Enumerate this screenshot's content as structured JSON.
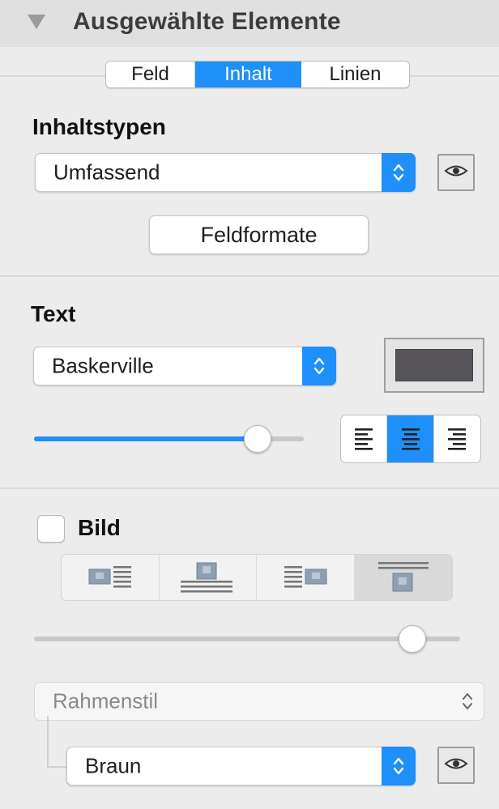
{
  "header": {
    "title": "Ausgewählte Elemente",
    "disclosure_icon": "disclosure-triangle-down-icon"
  },
  "tabs": [
    {
      "label": "Feld",
      "selected": false
    },
    {
      "label": "Inhalt",
      "selected": true
    },
    {
      "label": "Linien",
      "selected": false
    }
  ],
  "content_types": {
    "heading": "Inhaltstypen",
    "popup_value": "Umfassend",
    "eye_icon": "eye-icon",
    "field_formats_button": "Feldformate"
  },
  "text": {
    "heading": "Text",
    "font_value": "Baskerville",
    "color_hex": "#57545a",
    "size_slider_value": 0.82,
    "alignment_options": [
      "left",
      "center",
      "right"
    ],
    "alignment_selected": "center"
  },
  "image": {
    "label": "Bild",
    "checked": false,
    "layout_options": [
      "image-left-of-text",
      "image-above-text",
      "image-right-of-text",
      "image-below-text"
    ],
    "layout_selected": "image-below-text",
    "slider_value": 0.85,
    "frame_style_placeholder": "Rahmenstil",
    "frame_color_value": "Braun",
    "eye_icon": "eye-icon"
  },
  "colors": {
    "accent": "#1f8ff9",
    "panel": "#ececec",
    "header": "#e0e0e0"
  }
}
